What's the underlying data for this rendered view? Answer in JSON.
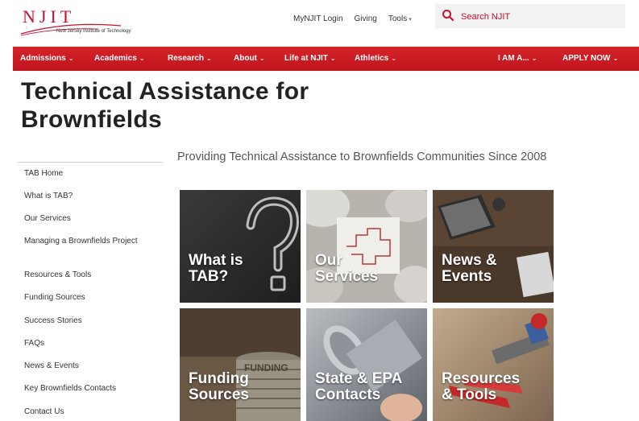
{
  "header": {
    "logo_text": "NJIT",
    "logo_subtext": "New Jersey Institute of Technology",
    "links": [
      "MyNJIT Login",
      "Giving",
      "Tools"
    ],
    "search_placeholder": "Search NJIT"
  },
  "nav": {
    "items": [
      "Admissions",
      "Academics",
      "Research",
      "About",
      "Life at NJIT",
      "Athletics"
    ],
    "right": [
      "I AM A...",
      "APPLY NOW"
    ]
  },
  "page": {
    "title_line1": "Technical Assistance for",
    "title_line2": "Brownfields",
    "tagline": "Providing Technical Assistance to Brownfields Communities Since 2008"
  },
  "sidebar": {
    "items": [
      "TAB Home",
      "What is TAB?",
      "Our Services",
      "Managing a Brownfields Project",
      "Resources & Tools",
      "Funding Sources",
      "Success Stories",
      "FAQs",
      "News & Events",
      "Key Brownfields Contacts",
      "Contact Us"
    ]
  },
  "tiles": [
    {
      "label": "What is\nTAB?"
    },
    {
      "label": "Our\nServices"
    },
    {
      "label": "News &\nEvents"
    },
    {
      "label": "Funding\nSources"
    },
    {
      "label": "State & EPA\nContacts"
    },
    {
      "label": "Resources\n& Tools"
    }
  ],
  "tile_texts": {
    "funding_sign": "FUNDING"
  },
  "colors": {
    "brand_red": "#d11f26",
    "dark_text": "#222222"
  }
}
